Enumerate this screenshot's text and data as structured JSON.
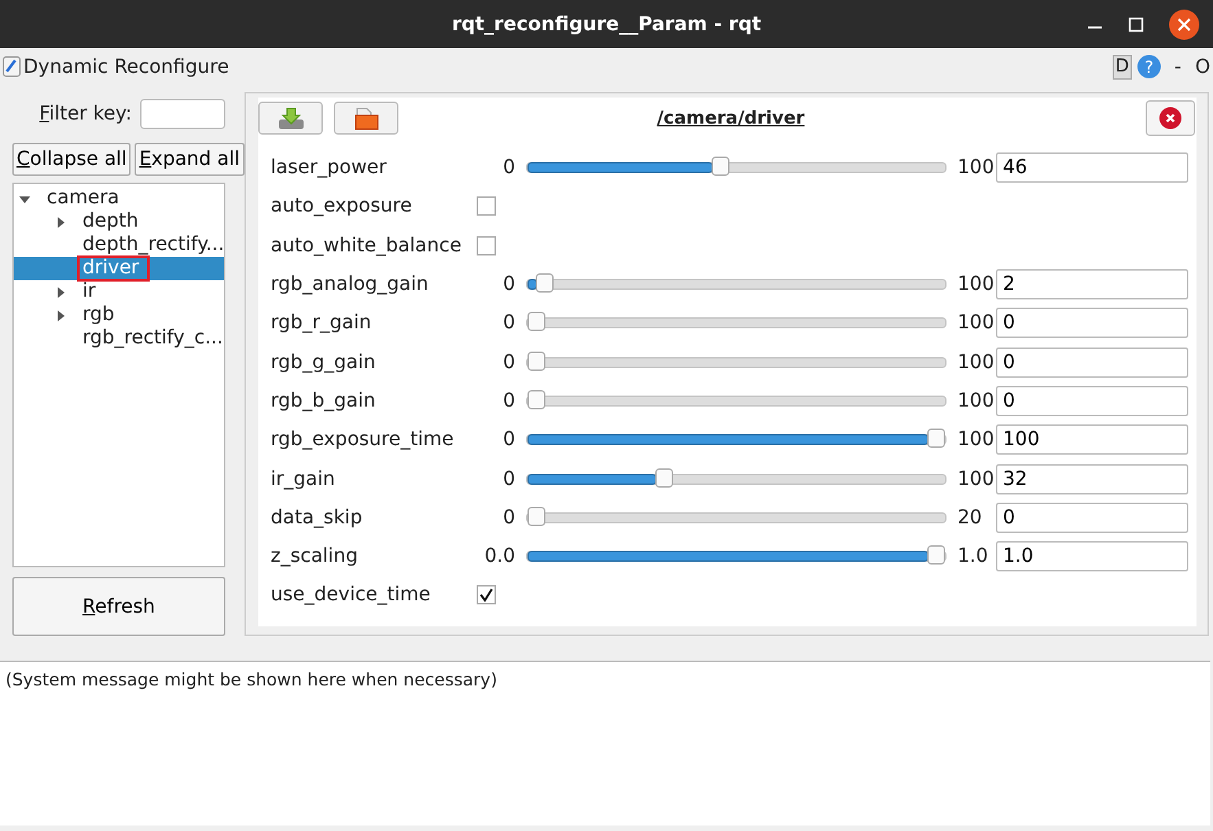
{
  "window": {
    "title": "rqt_reconfigure__Param - rqt",
    "controls": [
      "D",
      "?",
      "-",
      "O"
    ]
  },
  "plugin": {
    "title": "Dynamic Reconfigure"
  },
  "filter": {
    "label": "Filter key:"
  },
  "buttons": {
    "collapse": "Collapse all",
    "expand": "Expand all",
    "refresh": "Refresh"
  },
  "tree": [
    {
      "label": "camera",
      "kind": "branch",
      "expanded": true,
      "selected": false,
      "children": [
        {
          "label": "depth",
          "kind": "branch",
          "expanded": false,
          "selected": false
        },
        {
          "label": "depth_rectify...",
          "kind": "leaf",
          "selected": false
        },
        {
          "label": "driver",
          "kind": "leaf",
          "selected": true
        },
        {
          "label": "ir",
          "kind": "branch",
          "expanded": false,
          "selected": false
        },
        {
          "label": "rgb",
          "kind": "branch",
          "expanded": false,
          "selected": false
        },
        {
          "label": "rgb_rectify_c...",
          "kind": "leaf",
          "selected": false
        }
      ]
    }
  ],
  "panel": {
    "title": "/camera/driver"
  },
  "params": [
    {
      "name": "laser_power",
      "kind": "slider",
      "min": "0",
      "max": "100",
      "value": "46",
      "level": 0.46
    },
    {
      "name": "auto_exposure",
      "kind": "checkbox",
      "checked": false
    },
    {
      "name": "auto_white_balance",
      "kind": "checkbox",
      "checked": false
    },
    {
      "name": "rgb_analog_gain",
      "kind": "slider",
      "min": "0",
      "max": "100",
      "value": "2",
      "level": 0.02
    },
    {
      "name": "rgb_r_gain",
      "kind": "slider",
      "min": "0",
      "max": "100",
      "value": "0",
      "level": 0
    },
    {
      "name": "rgb_g_gain",
      "kind": "slider",
      "min": "0",
      "max": "100",
      "value": "0",
      "level": 0
    },
    {
      "name": "rgb_b_gain",
      "kind": "slider",
      "min": "0",
      "max": "100",
      "value": "0",
      "level": 0
    },
    {
      "name": "rgb_exposure_time",
      "kind": "slider",
      "min": "0",
      "max": "100",
      "value": "100",
      "level": 1
    },
    {
      "name": "ir_gain",
      "kind": "slider",
      "min": "0",
      "max": "100",
      "value": "32",
      "level": 0.32
    },
    {
      "name": "data_skip",
      "kind": "slider",
      "min": "0",
      "max": "20",
      "value": "0",
      "level": 0
    },
    {
      "name": "z_scaling",
      "kind": "slider",
      "min": "0.0",
      "max": "1.0",
      "value": "1.0",
      "level": 1
    },
    {
      "name": "use_device_time",
      "kind": "checkbox",
      "checked": true
    }
  ],
  "status": {
    "message": "(System message might be shown here when necessary)"
  }
}
